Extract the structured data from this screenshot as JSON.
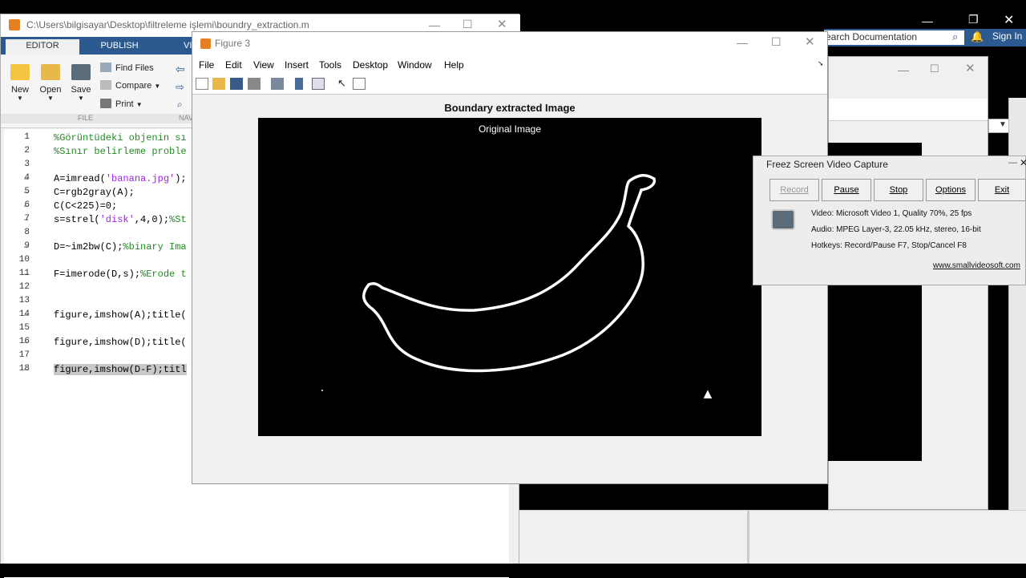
{
  "editor": {
    "title": "C:\\Users\\bilgisayar\\Desktop\\filtreleme işlemi\\boundry_extraction.m",
    "tabs": [
      "EDITOR",
      "PUBLISH",
      "VI"
    ],
    "buttons": {
      "new": "New",
      "open": "Open",
      "save": "Save"
    },
    "small_buttons": {
      "find": "Find Files",
      "compare": "Compare",
      "print": "Print"
    },
    "section_label": "FILE",
    "section_label_2": "NAV",
    "lines": [
      {
        "n": "1",
        "dash": "",
        "code": "%Görüntüdeki objenin sı",
        "type": "cmt"
      },
      {
        "n": "2",
        "dash": "",
        "code": "%Sınır belirleme proble",
        "type": "cmt"
      },
      {
        "n": "3",
        "dash": "",
        "code": "",
        "type": "code"
      },
      {
        "n": "4",
        "dash": "–",
        "code": "A=imread('banana.jpg');",
        "type": "code"
      },
      {
        "n": "5",
        "dash": "–",
        "code": "C=rgb2gray(A);",
        "type": "code"
      },
      {
        "n": "6",
        "dash": "–",
        "code": "C(C<225)=0;",
        "type": "code"
      },
      {
        "n": "7",
        "dash": "–",
        "code": "s=strel('disk',4,0);%St",
        "type": "code"
      },
      {
        "n": "8",
        "dash": "",
        "code": "",
        "type": "code"
      },
      {
        "n": "9",
        "dash": "–",
        "code": "D=~im2bw(C);%binary Ima",
        "type": "code"
      },
      {
        "n": "10",
        "dash": "",
        "code": "",
        "type": "code"
      },
      {
        "n": "11",
        "dash": "–",
        "code": "F=imerode(D,s);%Erode t",
        "type": "code"
      },
      {
        "n": "12",
        "dash": "",
        "code": "",
        "type": "code"
      },
      {
        "n": "13",
        "dash": "",
        "code": "",
        "type": "code"
      },
      {
        "n": "14",
        "dash": "–",
        "code": "figure,imshow(A);title(",
        "type": "code"
      },
      {
        "n": "15",
        "dash": "",
        "code": "",
        "type": "code"
      },
      {
        "n": "16",
        "dash": "–",
        "code": "figure,imshow(D);title(",
        "type": "code"
      },
      {
        "n": "17",
        "dash": "",
        "code": "",
        "type": "code"
      },
      {
        "n": "18",
        "dash": "–",
        "code": "figure,imshow(D-F);titl",
        "type": "sel"
      }
    ]
  },
  "matlab": {
    "search_placeholder": "earch Documentation",
    "sign_in": "Sign In"
  },
  "figure": {
    "title": "Figure 3",
    "menu": [
      "File",
      "Edit",
      "View",
      "Insert",
      "Tools",
      "Desktop",
      "Window",
      "Help"
    ],
    "axes_title": "Boundary extracted Image",
    "image_label": "Original Image"
  },
  "capture": {
    "title": "Freez Screen Video Capture",
    "buttons": [
      "Record",
      "Pause",
      "Stop",
      "Options",
      "Exit"
    ],
    "video": "Video: Microsoft Video 1, Quality 70%, 25 fps",
    "audio": "Audio: MPEG Layer-3, 22.05 kHz, stereo, 16-bit",
    "hotkeys": "Hotkeys: Record/Pause F7, Stop/Cancel F8",
    "link": "www.smallvideosoft.com"
  },
  "colors": {
    "ribbon_blue": "#2c5a8f",
    "comment": "#228b22",
    "string": "#a020f0"
  }
}
